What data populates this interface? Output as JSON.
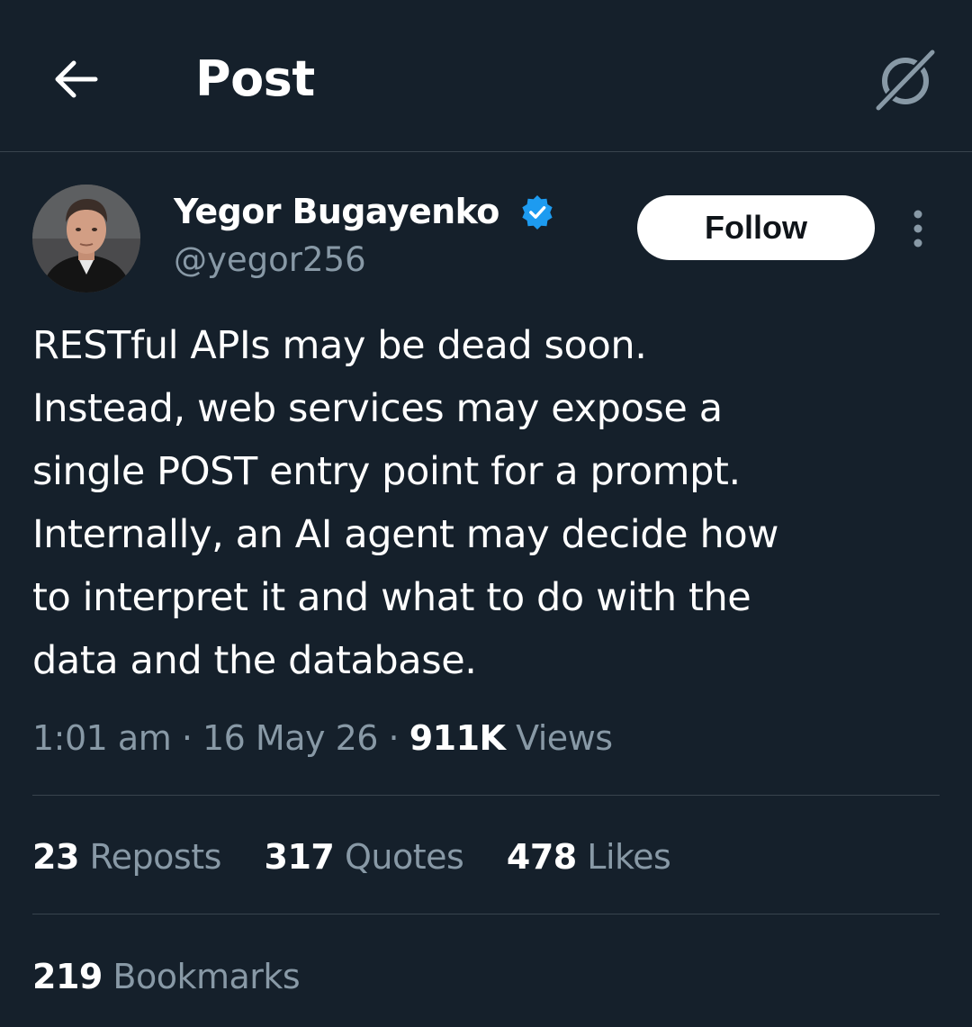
{
  "header": {
    "title": "Post",
    "back_icon": "arrow-left-icon",
    "grok_icon": "grok-icon"
  },
  "author": {
    "name": "Yegor Bugayenko",
    "handle": "@yegor256",
    "verified_icon": "verified-badge-icon",
    "verified_color": "#1d9bf0"
  },
  "actions": {
    "follow_label": "Follow",
    "more_icon": "more-vertical-icon"
  },
  "post": {
    "lines": [
      "RESTful APIs may be dead soon.",
      "Instead, web services may expose a",
      "single POST entry point for a prompt.",
      "Internally, an AI agent may decide how",
      "to interpret it and what to do with the",
      "data and the database."
    ],
    "time": "1:01 am",
    "date": "16 May 26",
    "separator": "·",
    "views_count": "911K",
    "views_label": "Views"
  },
  "stats": {
    "reposts_count": "23",
    "reposts_label": "Reposts",
    "quotes_count": "317",
    "quotes_label": "Quotes",
    "likes_count": "478",
    "likes_label": "Likes",
    "bookmarks_count": "219",
    "bookmarks_label": "Bookmarks"
  },
  "colors": {
    "background": "#15202b",
    "secondary_text": "#8899a6",
    "divider": "#38444d"
  }
}
